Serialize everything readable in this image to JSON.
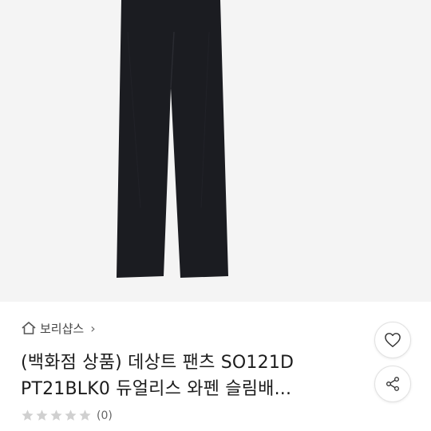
{
  "product": {
    "image_alt": "black slim pants",
    "store_name": "보리샵스",
    "title_line1": "(백화점 상품) 데상트 팬츠 SO121D",
    "title_line2": "PT21BLK0 듀얼리스 와펜 슬림배...",
    "review_count": "(0)",
    "rating_stars": 0
  },
  "icons": {
    "store": "home-icon",
    "store_chevron": "chevron-right-icon",
    "like": "heart-outline-icon",
    "share": "share-icon"
  },
  "colors": {
    "pants": "#1b1c21",
    "star_empty": "#d0d0d0",
    "text": "#1c1c1c"
  }
}
